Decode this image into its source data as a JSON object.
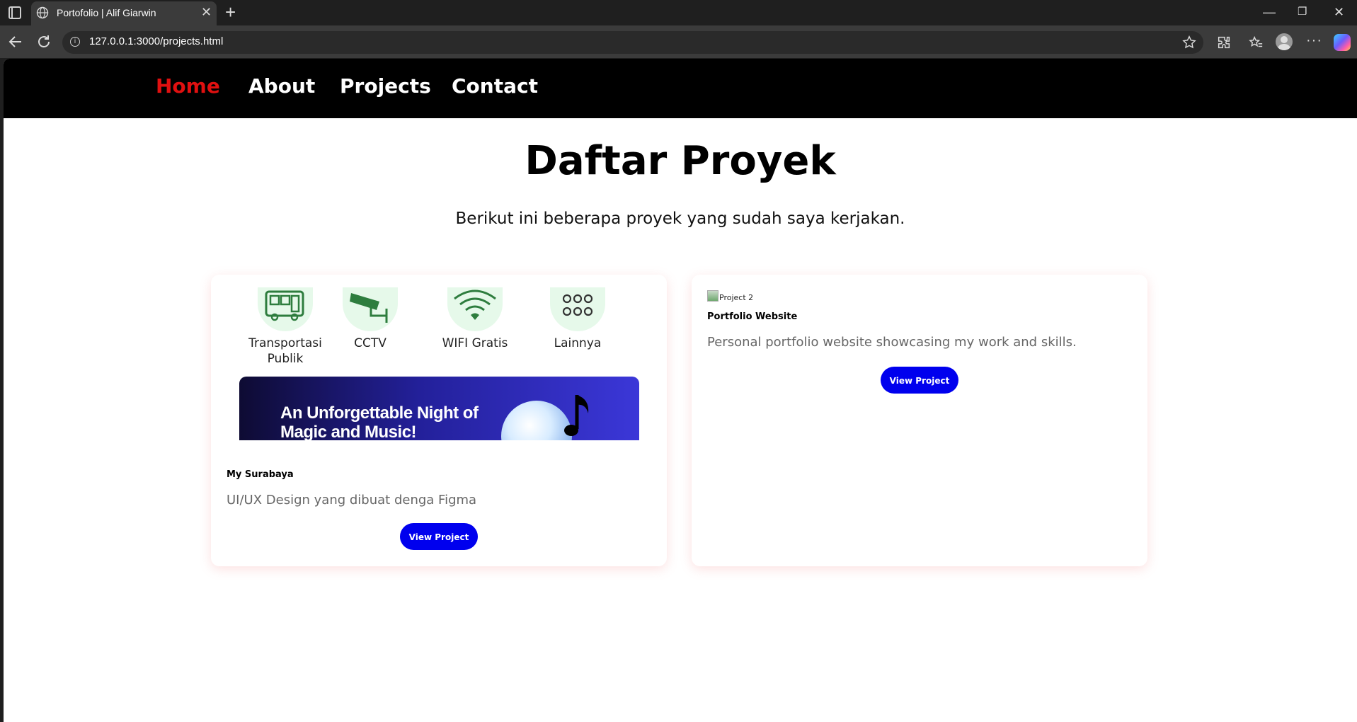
{
  "browser": {
    "tab_title": "Portofolio | Alif Giarwin",
    "url": "127.0.0.1:3000/projects.html"
  },
  "nav": {
    "items": [
      {
        "label": "Home",
        "active": true
      },
      {
        "label": "About",
        "active": false
      },
      {
        "label": "Projects",
        "active": false
      },
      {
        "label": "Contact",
        "active": false
      }
    ],
    "active_color": "#e01010"
  },
  "header": {
    "title": "Daftar Proyek",
    "subtitle": "Berikut ini beberapa proyek yang sudah saya kerjakan."
  },
  "projects": [
    {
      "title": "My Surabaya",
      "description": "UI/UX Design yang dibuat denga Figma",
      "button_label": "View Project",
      "image": {
        "features": [
          "Transportasi Publik",
          "CCTV",
          "WIFI Gratis",
          "Lainnya"
        ],
        "banner_text": "An Unforgettable Night of Magic and Music!"
      }
    },
    {
      "title": "Portfolio Website",
      "description": "Personal portfolio website showcasing my work and skills.",
      "button_label": "View Project",
      "image_alt": "Project 2"
    }
  ],
  "colors": {
    "button": "#0000ee",
    "nav_bg": "#000000"
  }
}
